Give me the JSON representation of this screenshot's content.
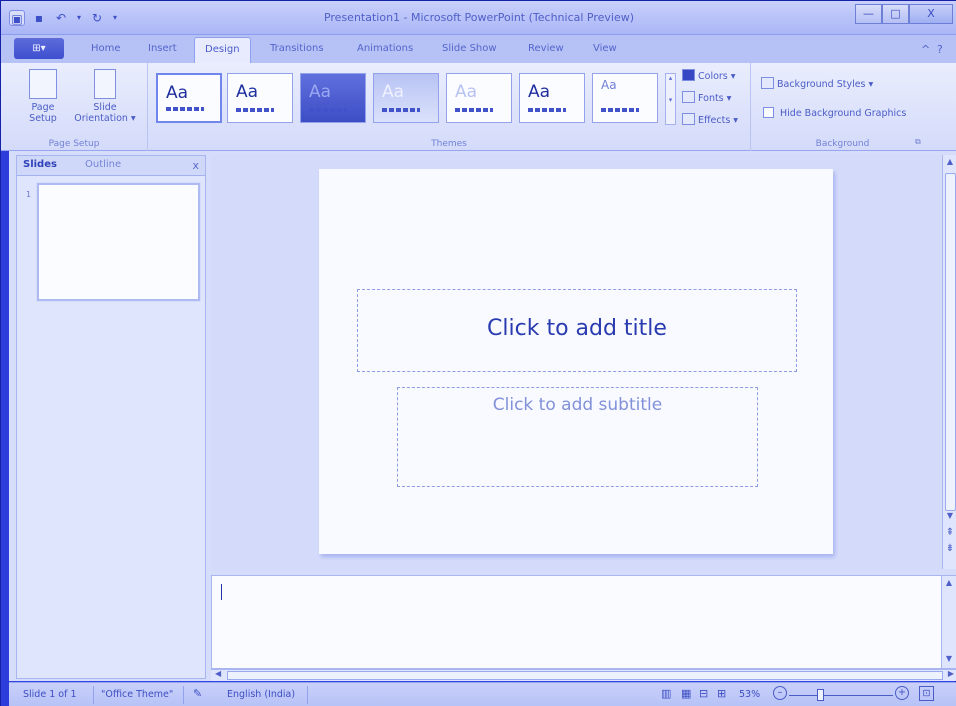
{
  "window": {
    "title": "Presentation1  -  Microsoft PowerPoint (Technical Preview)",
    "minimize": "—",
    "maximize": "□",
    "close": "X"
  },
  "qat": {
    "app_icon": "powerpoint-icon",
    "save": "save-icon",
    "undo": "undo-icon",
    "redo": "redo-icon",
    "customize": "dropdown-icon"
  },
  "tabs": {
    "office_button": "⊞▾",
    "items": [
      "Home",
      "Insert",
      "Design",
      "Transitions",
      "Animations",
      "Slide Show",
      "Review",
      "View"
    ],
    "active": "Design",
    "minimize_ribbon": "^",
    "help": "?"
  },
  "ribbon": {
    "page_setup": {
      "label": "Page Setup",
      "page_setup_btn": "Page\nSetup",
      "slide_orientation_btn": "Slide\nOrientation ▾"
    },
    "themes": {
      "label": "Themes",
      "thumbs": [
        "Aa",
        "Aa",
        "Aa",
        "Aa",
        "Aa",
        "Aa",
        "Aa"
      ],
      "scroll_up": "▴",
      "scroll_more": "▾"
    },
    "colors": "Colors ▾",
    "fonts": "Fonts ▾",
    "effects": "Effects ▾",
    "background": {
      "label": "Background",
      "styles": "Background Styles ▾",
      "hide_graphics": "Hide Background Graphics",
      "launcher": "⧉"
    }
  },
  "slides_pane": {
    "tab_slides": "Slides",
    "tab_outline": "Outline",
    "close": "x",
    "slide_number": "1"
  },
  "slide": {
    "title_placeholder": "Click to add title",
    "subtitle_placeholder": "Click to add subtitle"
  },
  "notes": {
    "text": ""
  },
  "status": {
    "slide_info": "Slide 1 of 1",
    "theme": "\"Office Theme\"",
    "language": "English (India)",
    "zoom": "53%",
    "zoom_out": "–",
    "zoom_in": "+"
  }
}
